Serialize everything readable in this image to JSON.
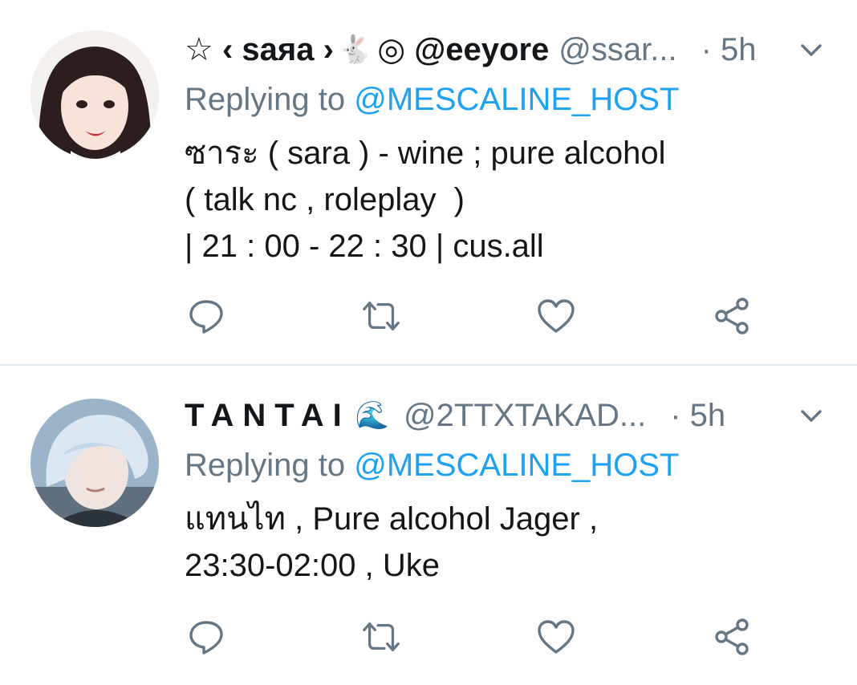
{
  "tweets": [
    {
      "display_name": "☆ ‹ saяa › ",
      "display_name_suffix": " ◎ @eeyore",
      "emoji": "🐇",
      "handle": "@ssar...",
      "time": "· 5h",
      "replying_prefix": "Replying to ",
      "replying_to": "@MESCALINE_HOST",
      "body": "ซาระ ( sara ) - wine ; pure alcohol\n( talk nc , roleplay  )\n| 21 : 00 - 22 : 30 | cus.all",
      "avatar_icon": "avatar-photo-woman",
      "colors": {
        "avatar_bg": "#e9dcd6"
      }
    },
    {
      "display_name": "TANTAI",
      "emoji": "🌊",
      "handle": "@2TTXTAKAD...",
      "time": "· 5h",
      "replying_prefix": "Replying to ",
      "replying_to": "@MESCALINE_HOST",
      "body": "แทนไท , Pure alcohol Jager ,\n23:30-02:00 , Uke",
      "avatar_icon": "avatar-photo-man",
      "colors": {
        "avatar_bg": "#b9cfe4"
      }
    }
  ],
  "icons": {
    "reply": "reply-icon",
    "retweet": "retweet-icon",
    "like": "heart-icon",
    "share": "share-icon",
    "more": "chevron-down-icon"
  },
  "colors": {
    "text": "#14171a",
    "secondary": "#657786",
    "link": "#1da1f2",
    "divider": "#e1e8ed"
  }
}
